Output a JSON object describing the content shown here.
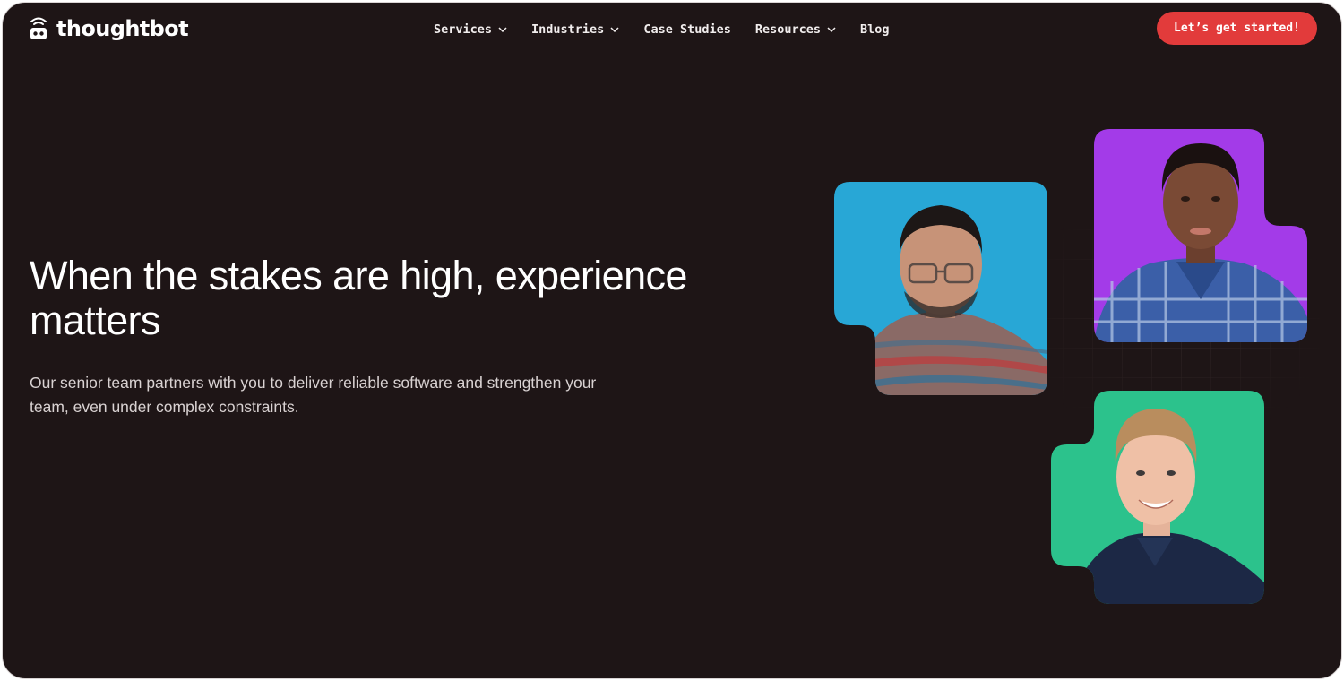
{
  "brand": {
    "name": "thoughtbot",
    "logo_icon": "robot-icon"
  },
  "nav": {
    "items": [
      {
        "label": "Services",
        "has_dropdown": true
      },
      {
        "label": "Industries",
        "has_dropdown": true
      },
      {
        "label": "Case Studies",
        "has_dropdown": false
      },
      {
        "label": "Resources",
        "has_dropdown": true
      },
      {
        "label": "Blog",
        "has_dropdown": false
      }
    ],
    "dropdown_icon": "chevron-down-icon"
  },
  "cta": {
    "label": "Let’s get started!",
    "color": "#e23b3b"
  },
  "hero": {
    "title": "When the stakes are high, experience matters",
    "subtitle": "Our senior team partners with you to deliver reliable software and strengthen your team, even under complex constraints."
  },
  "photos": [
    {
      "subject": "man-with-glasses-portrait",
      "background": "#28a7d6"
    },
    {
      "subject": "man-in-plaid-shirt-portrait",
      "background": "#a33be8"
    },
    {
      "subject": "smiling-man-portrait",
      "background": "#2cc28c"
    }
  ],
  "colors": {
    "background": "#1e1516",
    "text": "#ffffff",
    "muted_text": "#d9d2d2",
    "accent": "#e23b3b"
  }
}
